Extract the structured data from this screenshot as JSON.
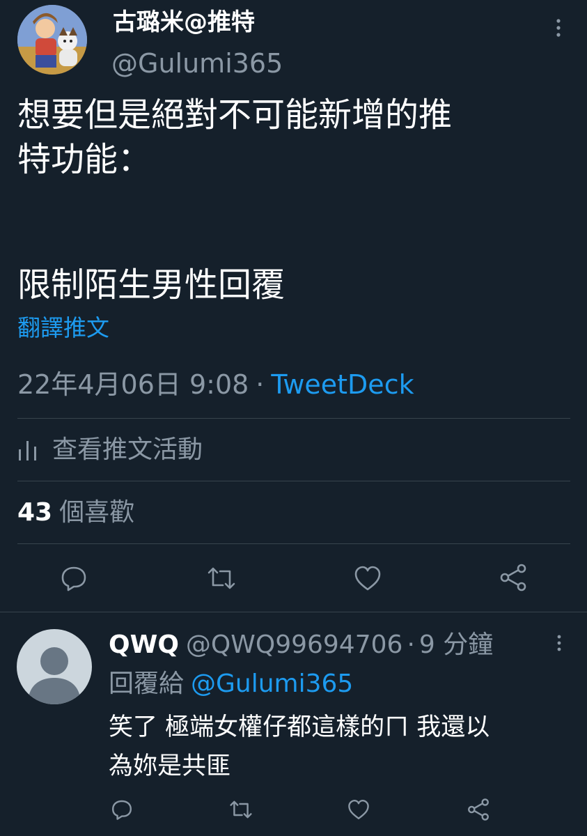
{
  "tweet": {
    "author": {
      "display_name": "古璐米@推特",
      "handle": "@Gulumi365"
    },
    "text_lines": [
      "想要但是絕對不可能新增的推",
      "特功能：",
      "",
      "限制陌生男性回覆"
    ],
    "translate_label": "翻譯推文",
    "timestamp": "22年4月06日 9:08",
    "separator": "·",
    "source": "TweetDeck",
    "activity_label": "查看推文活動",
    "likes_count": "43",
    "likes_label": "個喜歡",
    "icons": [
      "more-vertical-icon",
      "bar-chart-icon",
      "reply-icon",
      "retweet-icon",
      "like-icon",
      "share-icon"
    ]
  },
  "reply": {
    "display_name": "QWQ",
    "handle": "@QWQ99694706",
    "separator": "·",
    "time": "9 分鐘",
    "replying_to_label": "回覆給",
    "replying_to_handle": "@Gulumi365",
    "text_lines": [
      "笑了 極端女權仔都這樣的ㄇ 我還以",
      "為妳是共匪"
    ]
  },
  "colors": {
    "background": "#15202b",
    "text_primary": "#ffffff",
    "text_secondary": "#8b98a5",
    "accent": "#1d9bf0",
    "divider": "#38444d"
  }
}
